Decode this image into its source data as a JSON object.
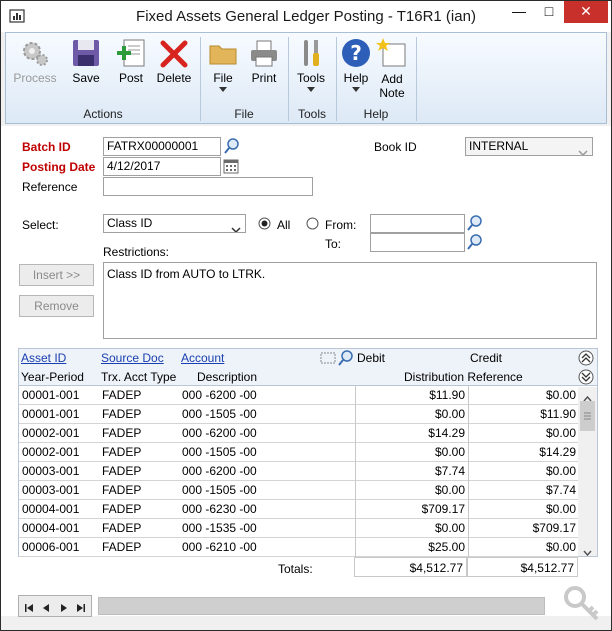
{
  "window": {
    "title": "Fixed Assets General Ledger Posting  -  T16R1 (ian)",
    "min_glyph": "—",
    "max_glyph": "□",
    "close_glyph": "✕"
  },
  "ribbon": {
    "groups": [
      {
        "label": "Actions",
        "buttons": [
          "Process",
          "Save",
          "Post",
          "Delete"
        ]
      },
      {
        "label": "File",
        "buttons": [
          "File",
          "Print"
        ]
      },
      {
        "label": "Tools",
        "buttons": [
          "Tools"
        ]
      },
      {
        "label": "Help",
        "buttons": [
          "Help",
          "Add Note"
        ]
      }
    ],
    "add_note_line1": "Add",
    "add_note_line2": "Note"
  },
  "form": {
    "batch_id_label": "Batch ID",
    "batch_id": "FATRX00000001",
    "posting_date_label": "Posting Date",
    "posting_date": "4/12/2017",
    "reference_label": "Reference",
    "reference": "",
    "book_id_label": "Book ID",
    "book_id": "INTERNAL",
    "select_label": "Select:",
    "select_value": "Class ID",
    "all_label": "All",
    "from_label": "From:",
    "to_label": "To:",
    "from_value": "",
    "to_value": "",
    "range_mode": "All",
    "restrictions_label": "Restrictions:",
    "restrictions_text": "Class ID from AUTO to LTRK.",
    "insert_label": "Insert >>",
    "remove_label": "Remove"
  },
  "grid": {
    "headers_row1": {
      "asset_id": "Asset ID",
      "source_doc": "Source Doc",
      "account": "Account",
      "debit": "Debit",
      "credit": "Credit"
    },
    "headers_row2": {
      "year_period": "Year-Period",
      "trx_acct_type": "Trx. Acct Type",
      "description": "Description",
      "distribution_reference": "Distribution Reference"
    },
    "rows": [
      {
        "asset": "00001-001",
        "type": "FADEP",
        "account": "000 -6200 -00",
        "debit": "$11.90",
        "credit": "$0.00"
      },
      {
        "asset": "00001-001",
        "type": "FADEP",
        "account": "000 -1505 -00",
        "debit": "$0.00",
        "credit": "$11.90"
      },
      {
        "asset": "00002-001",
        "type": "FADEP",
        "account": "000 -6200 -00",
        "debit": "$14.29",
        "credit": "$0.00"
      },
      {
        "asset": "00002-001",
        "type": "FADEP",
        "account": "000 -1505 -00",
        "debit": "$0.00",
        "credit": "$14.29"
      },
      {
        "asset": "00003-001",
        "type": "FADEP",
        "account": "000 -6200 -00",
        "debit": "$7.74",
        "credit": "$0.00"
      },
      {
        "asset": "00003-001",
        "type": "FADEP",
        "account": "000 -1505 -00",
        "debit": "$0.00",
        "credit": "$7.74"
      },
      {
        "asset": "00004-001",
        "type": "FADEP",
        "account": "000 -6230 -00",
        "debit": "$709.17",
        "credit": "$0.00"
      },
      {
        "asset": "00004-001",
        "type": "FADEP",
        "account": "000 -1535 -00",
        "debit": "$0.00",
        "credit": "$709.17"
      },
      {
        "asset": "00006-001",
        "type": "FADEP",
        "account": "000 -6210 -00",
        "debit": "$25.00",
        "credit": "$0.00"
      }
    ],
    "totals_label": "Totals:",
    "total_debit": "$4,512.77",
    "total_credit": "$4,512.77"
  },
  "colors": {
    "required_label": "#c00000",
    "link": "#1a3fb0",
    "ribbon_top": "#f7fbff",
    "ribbon_bottom": "#dde9f6"
  }
}
